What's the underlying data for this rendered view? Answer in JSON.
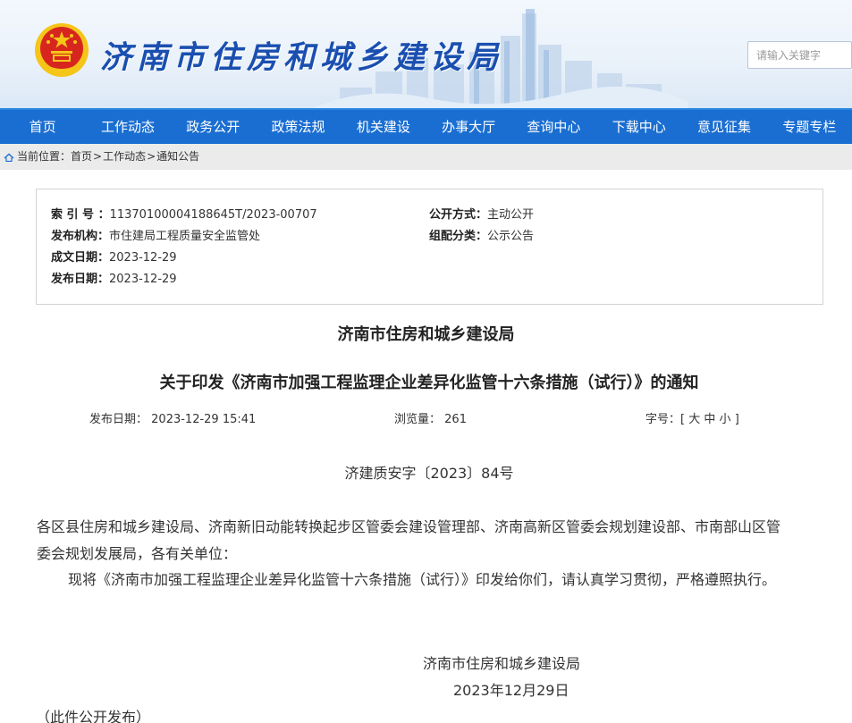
{
  "header": {
    "site_title": "济南市住房和城乡建设局",
    "search_placeholder": "请输入关键字"
  },
  "nav": {
    "items": [
      "首页",
      "工作动态",
      "政务公开",
      "政策法规",
      "机关建设",
      "办事大厅",
      "查询中心",
      "下载中心",
      "意见征集",
      "专题专栏"
    ]
  },
  "breadcrumb": {
    "label": "当前位置：",
    "items": [
      "首页",
      "工作动态",
      "通知公告"
    ],
    "separator": ">"
  },
  "meta": {
    "index_label": "索 引 号 ：",
    "index_value": "11370100004188645T/2023-00707",
    "org_label": "发布机构：",
    "org_value": "市住建局工程质量安全监管处",
    "created_label": "成文日期：",
    "created_value": "2023-12-29",
    "published_label": "发布日期：",
    "published_value": "2023-12-29",
    "disclosure_label": "公开方式：",
    "disclosure_value": "主动公开",
    "category_label": "组配分类：",
    "category_value": "公示公告"
  },
  "article": {
    "publisher": "济南市住房和城乡建设局",
    "title": "关于印发《济南市加强工程监理企业差异化监管十六条措施（试行）》的通知",
    "date_label": "发布日期：",
    "date_value": "2023-12-29 15:41",
    "views_label": "浏览量：",
    "views_value": "261",
    "font_label": "字号：[",
    "font_large": "大",
    "font_medium": "中",
    "font_small": "小",
    "font_close": "]",
    "doc_number": "济建质安字〔2023〕84号",
    "recipients_line1": "各区县住房和城乡建设局、济南新旧动能转换起步区管委会建设管理部、济南高新区管委会规划建设部、市南部山区管",
    "recipients_line2": "委会规划发展局，各有关单位：",
    "body": "现将《济南市加强工程监理企业差异化监管十六条措施（试行）》印发给你们，请认真学习贯彻，严格遵照执行。",
    "signature": "济南市住房和城乡建设局",
    "sign_date": "2023年12月29日",
    "footer_note": "（此件公开发布）"
  },
  "colors": {
    "nav_bg": "#1a6ed1",
    "title_blue": "#1a4fb0",
    "emblem_red": "#d7261e",
    "emblem_gold": "#f5c518"
  }
}
